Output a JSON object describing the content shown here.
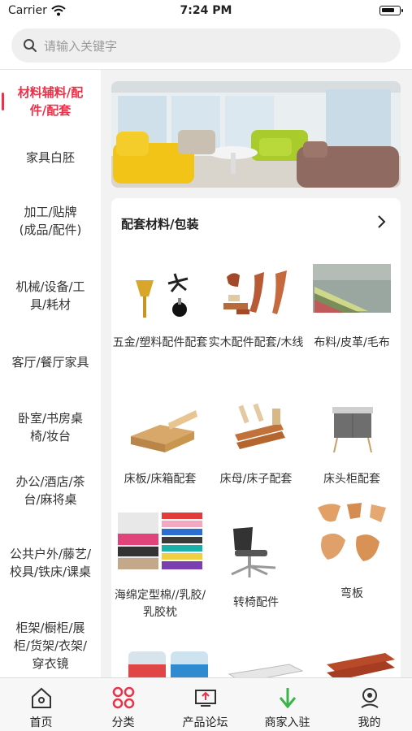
{
  "status_bar": {
    "carrier": "Carrier",
    "time": "7:24 PM"
  },
  "search": {
    "placeholder": "请输入关键字"
  },
  "sidebar": {
    "items": [
      {
        "label": "材料辅料/配件/配套",
        "active": true
      },
      {
        "label": "家具白胚"
      },
      {
        "label": "加工/贴牌(成品/配件)"
      },
      {
        "label": "机械/设备/工具/耗材"
      },
      {
        "label": "客厅/餐厅家具"
      },
      {
        "label": "卧室/书房桌椅/妆台"
      },
      {
        "label": "办公/酒店/茶台/麻将桌"
      },
      {
        "label": "公共户外/藤艺/校具/铁床/课桌"
      },
      {
        "label": "柜架/橱柜/展柜/货架/衣架/穿衣镜"
      }
    ]
  },
  "section": {
    "title": "配套材料/包装",
    "products": [
      {
        "name": "五金/塑料配件配套",
        "icon": "hardware-parts-image"
      },
      {
        "name": "实木配件配套/木线",
        "icon": "wood-parts-image"
      },
      {
        "name": "布料/皮革/毛布",
        "icon": "fabric-image"
      },
      {
        "name": "床板/床箱配套",
        "icon": "bed-board-image"
      },
      {
        "name": "床母/床子配套",
        "icon": "bed-slats-image"
      },
      {
        "name": "床头柜配套",
        "icon": "nightstand-image"
      },
      {
        "name": "海绵定型棉//乳胶/乳胶枕",
        "icon": "sponge-image"
      },
      {
        "name": "转椅配件",
        "icon": "swivel-chair-image"
      },
      {
        "name": "弯板",
        "icon": "bent-plywood-image"
      }
    ]
  },
  "tabbar": {
    "tabs": [
      {
        "label": "首页",
        "icon": "home-icon"
      },
      {
        "label": "分类",
        "icon": "category-icon",
        "active": true
      },
      {
        "label": "产品论坛",
        "icon": "forum-icon"
      },
      {
        "label": "商家入驻",
        "icon": "merchant-join-icon"
      },
      {
        "label": "我的",
        "icon": "profile-icon"
      }
    ]
  },
  "colors": {
    "accent": "#e8334a",
    "green": "#3bb54a"
  }
}
